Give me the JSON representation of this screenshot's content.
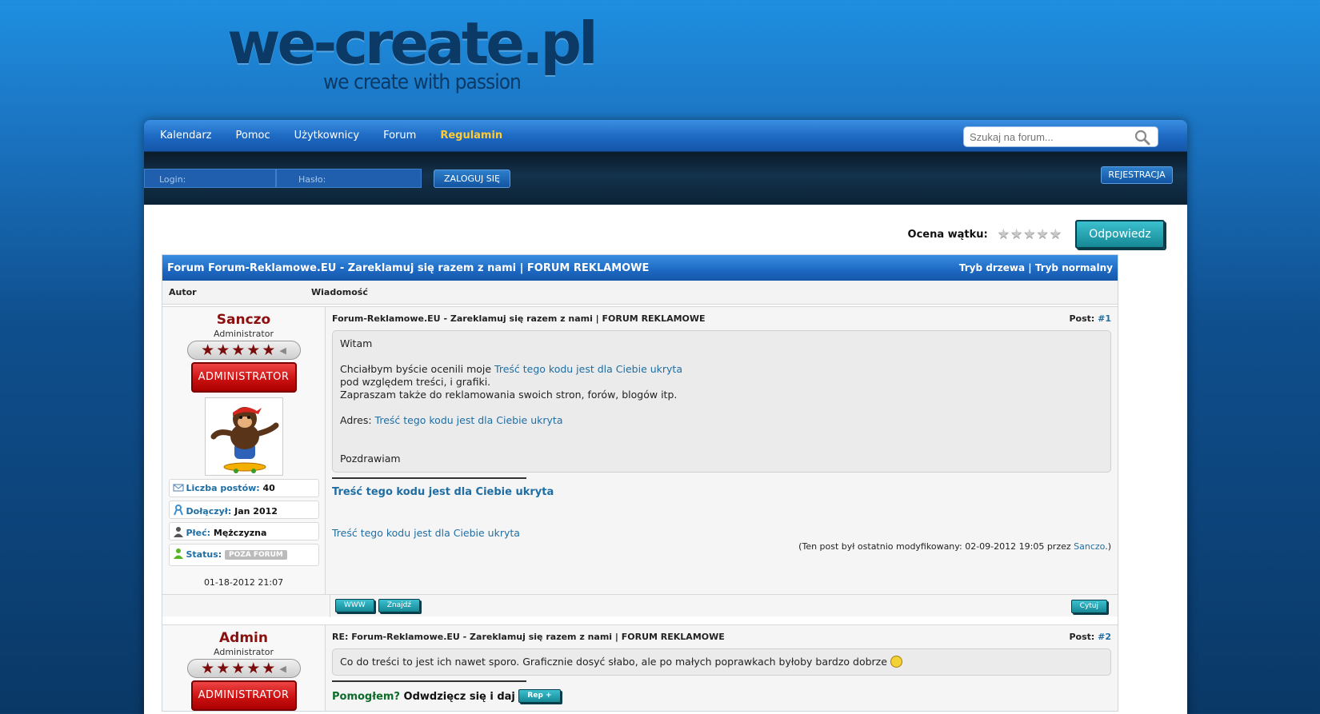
{
  "header": {
    "logo": "we-create.pl",
    "tagline": "we create with passion"
  },
  "nav": {
    "items": [
      "Kalendarz",
      "Pomoc",
      "Użytkownicy",
      "Forum",
      "Regulamin"
    ],
    "search_placeholder": "Szukaj na forum..."
  },
  "login": {
    "login_placeholder": "Login:",
    "password_placeholder": "Hasło:",
    "login_button": "ZALOGUJ SIĘ",
    "register_button": "REJESTRACJA"
  },
  "thread": {
    "rating_label": "Ocena wątku:",
    "reply_button": "Odpowiedz",
    "title": "Forum Forum-Reklamowe.EU - Zareklamuj się razem z nami | FORUM REKLAMOWE",
    "mode_tree": "Tryb drzewa",
    "mode_normal": "Tryb normalny",
    "mode_sep": "|",
    "col_author": "Autor",
    "col_message": "Wiadomość"
  },
  "posts": [
    {
      "author": "Sanczo",
      "role": "Administrator",
      "badge": "ADMINISTRATOR",
      "posts_label": "Liczba postów:",
      "posts_value": "40",
      "joined_label": "Dołączył:",
      "joined_value": "Jan 2012",
      "gender_label": "Płeć:",
      "gender_value": "Mężczyzna",
      "status_label": "Status:",
      "status_value": "POZA FORUM",
      "date": "01-18-2012 21:07",
      "title": "Forum-Reklamowe.EU - Zareklamuj się razem z nami | FORUM REKLAMOWE",
      "post_label": "Post:",
      "post_num": "#1",
      "body_greeting": "Witam",
      "body_line1_prefix": "Chciałbym byście ocenili moje",
      "hidden_link": "Treść tego kodu jest dla Ciebie ukryta",
      "body_line2": "pod względem treści, i grafiki.",
      "body_line3": "Zapraszam także do reklamowania swoich stron, forów, blogów itp.",
      "body_addr_label": "Adres:",
      "body_closing": "Pozdrawiam",
      "edit_note_prefix": "(Ten post był ostatnio modyfikowany: 02-09-2012 19:05 przez",
      "edit_note_user": "Sanczo",
      "edit_note_suffix": ".)",
      "btn_www": "WWW",
      "btn_find": "Znajdź",
      "btn_quote": "Cytuj"
    },
    {
      "author": "Admin",
      "role": "Administrator",
      "badge": "ADMINISTRATOR",
      "title": "RE: Forum-Reklamowe.EU - Zareklamuj się razem z nami | FORUM REKLAMOWE",
      "post_label": "Post:",
      "post_num": "#2",
      "body": "Co do treści to jest ich nawet sporo. Graficznie dosyć słabo, ale po małych poprawkach byłoby bardzo dobrze",
      "helped_green": "Pomogłem?",
      "helped_rest": "Odwdzięcz się i daj",
      "rep_button": "Rep +"
    }
  ]
}
